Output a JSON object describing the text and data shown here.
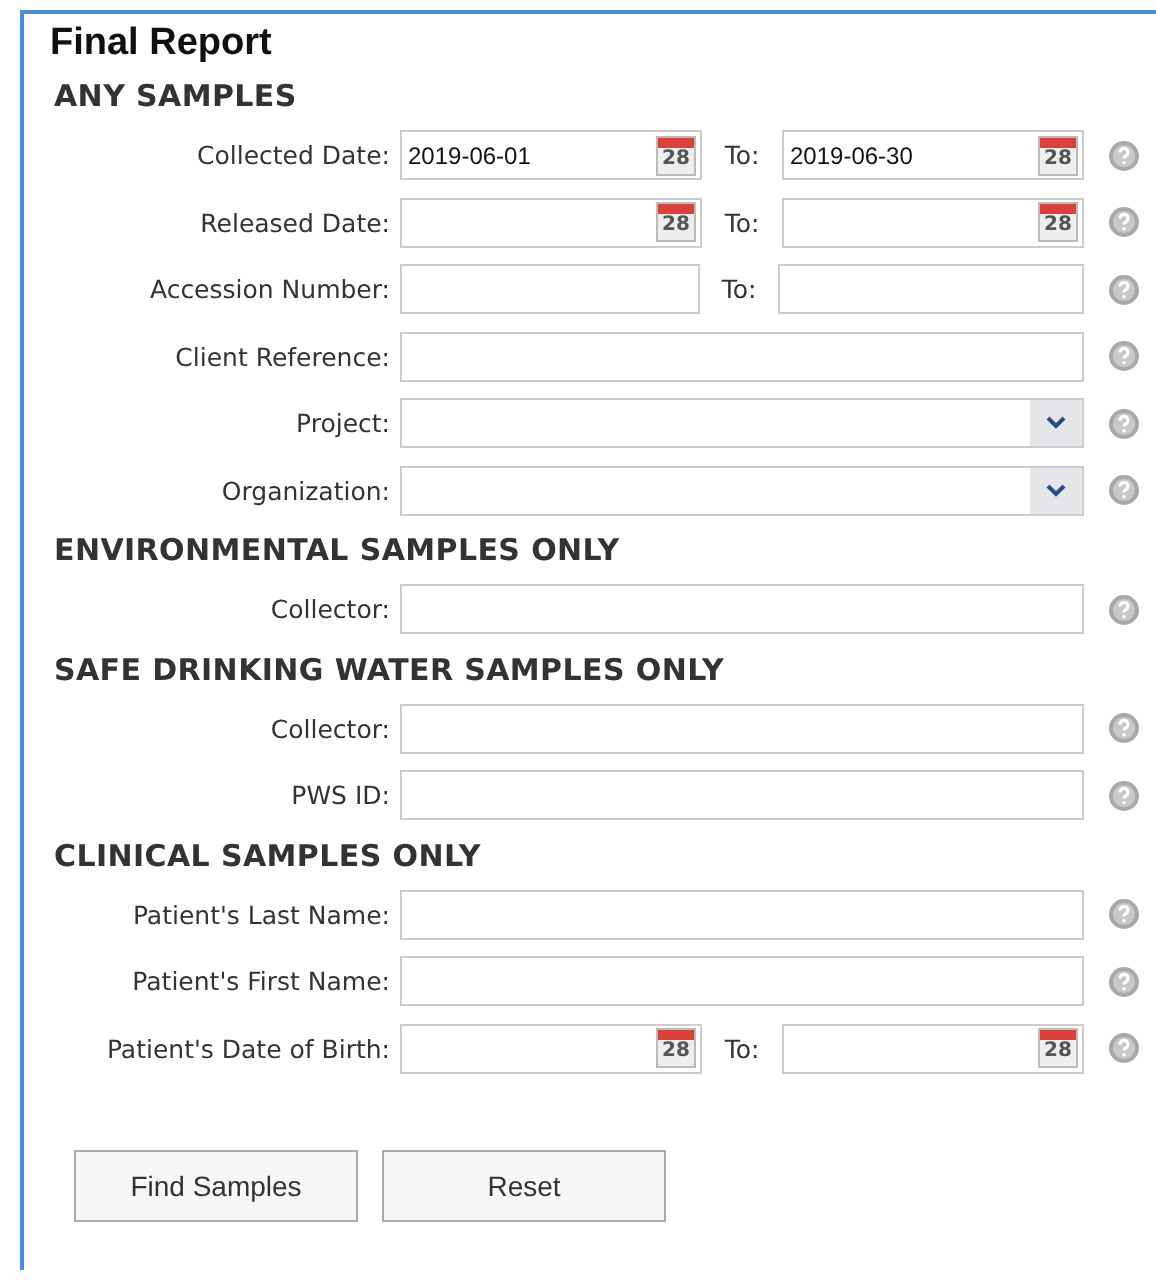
{
  "title": "Final Report",
  "sections": [
    {
      "heading": "ANY SAMPLES",
      "rows": [
        {
          "kind": "date_range",
          "label": "Collected Date:",
          "from": "2019-06-01",
          "to_label": "To:",
          "to": "2019-06-30",
          "from_picker": "28",
          "to_picker": "28"
        },
        {
          "kind": "date_range",
          "label": "Released Date:",
          "to_label": "To:",
          "from_picker": "28",
          "to_picker": "28"
        },
        {
          "kind": "text_range",
          "label": "Accession Number:",
          "to_label": "To:"
        },
        {
          "kind": "text",
          "label": "Client Reference:"
        },
        {
          "kind": "select",
          "label": "Project:"
        },
        {
          "kind": "select",
          "label": "Organization:"
        }
      ]
    },
    {
      "heading": "ENVIRONMENTAL SAMPLES ONLY",
      "rows": [
        {
          "kind": "text",
          "label": "Collector:"
        }
      ]
    },
    {
      "heading": "SAFE DRINKING WATER SAMPLES ONLY",
      "rows": [
        {
          "kind": "text",
          "label": "Collector:"
        },
        {
          "kind": "text",
          "label": "PWS ID:"
        }
      ]
    },
    {
      "heading": "CLINICAL SAMPLES ONLY",
      "rows": [
        {
          "kind": "text",
          "label": "Patient's Last Name:"
        },
        {
          "kind": "text",
          "label": "Patient's First Name:"
        },
        {
          "kind": "date_range",
          "label": "Patient's Date of Birth:",
          "to_label": "To:",
          "from_picker": "28",
          "to_picker": "28"
        }
      ]
    }
  ],
  "buttons": [
    "Find Samples",
    "Reset"
  ]
}
